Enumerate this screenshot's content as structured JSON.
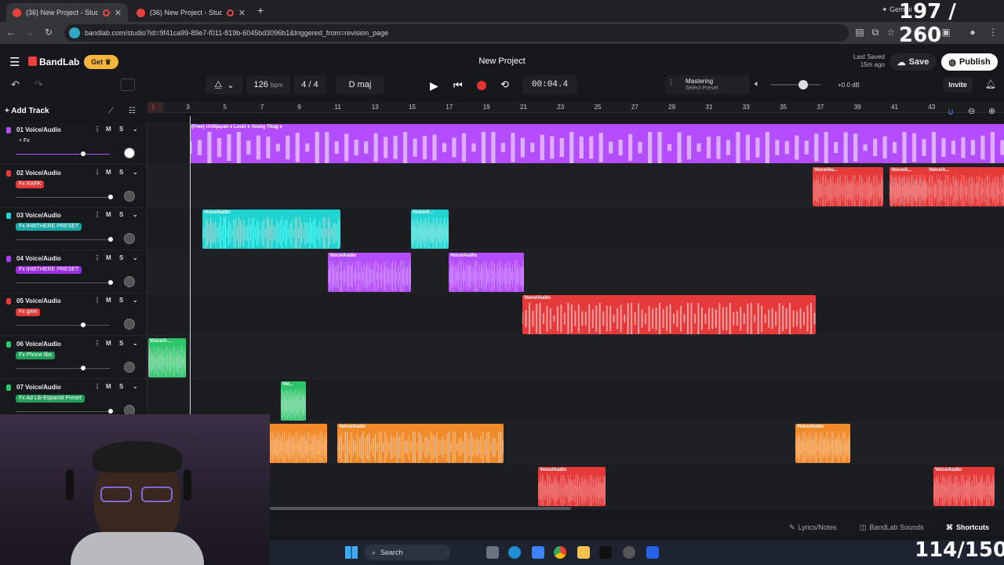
{
  "browser": {
    "tabs": [
      {
        "label": "(36) New Project - Studio",
        "active": true
      },
      {
        "label": "(36) New Project - Studio",
        "active": false
      }
    ],
    "new_tab": "+",
    "url": "bandlab.com/studio?id=9f41ca99-89e7-f011-819b-6045bd3096b1&triggered_from=revision_page",
    "gemini_label": "Gemini"
  },
  "header": {
    "logo": "BandLab",
    "get_label": "Get",
    "project_title": "New Project",
    "last_saved_label": "Last Saved",
    "last_saved_time": "15m ago",
    "save_label": "Save",
    "publish_label": "Publish"
  },
  "transport": {
    "bpm": "126",
    "bpm_unit": "bpm",
    "time_sig": "4 / 4",
    "key": "D maj",
    "time": "00:04.4",
    "mastering": "Mastering",
    "select_preset": "Select Preset",
    "volume_db": "+0.0 dB",
    "invite_label": "Invite"
  },
  "add_track_label": "Add Track",
  "ruler": [
    "1",
    "3",
    "5",
    "7",
    "9",
    "11",
    "13",
    "15",
    "17",
    "19",
    "21",
    "23",
    "25",
    "27",
    "29",
    "31",
    "33",
    "35",
    "37",
    "39",
    "41",
    "43"
  ],
  "tracks": [
    {
      "num": "01",
      "name": "Voice/Audio",
      "fx": "+ Fx",
      "color": "#b44cff",
      "fxbg": "transparent",
      "vol": 0.7
    },
    {
      "num": "02",
      "name": "Voice/Audio",
      "fx": "Fx RAFK",
      "color": "#e63a3a",
      "fxbg": "#e63a3a",
      "vol": 0.98
    },
    {
      "num": "03",
      "name": "Voice/Audio",
      "fx": "Fx IH8ITHERE PRESET",
      "color": "#1fd4d0",
      "fxbg": "#1aa8a6",
      "vol": 0.98
    },
    {
      "num": "04",
      "name": "Voice/Audio",
      "fx": "Fx IH8ITHERE PRESET",
      "color": "#a23cff",
      "fxbg": "#9a2fe0",
      "vol": 0.98
    },
    {
      "num": "05",
      "name": "Voice/Audio",
      "fx": "Fx grim",
      "color": "#e63a3a",
      "fxbg": "#e63a3a",
      "vol": 0.7
    },
    {
      "num": "06",
      "name": "Voice/Audio",
      "fx": "Fx Phone libs",
      "color": "#2ec46a",
      "fxbg": "#22a05a",
      "vol": 0.7
    },
    {
      "num": "07",
      "name": "Voice/Audio",
      "fx": "Fx Ad Lib Espacial Preset",
      "color": "#2ec46a",
      "fxbg": "#22a05a",
      "vol": 0.98
    }
  ],
  "mute_label": "M",
  "solo_label": "S",
  "clip_titles": {
    "main": "(Free) Untiljapan x Lucki x Young Thug x",
    "va": "Voice/Audio",
    "va_a": "Voice/A...",
    "va_au": "Voice/Au...",
    "vo": "Voi..."
  },
  "bottom": {
    "lyrics": "Lyrics/Notes",
    "sounds": "BandLab Sounds",
    "shortcuts": "Shortcuts"
  },
  "taskbar": {
    "search": "Search"
  },
  "overlay": {
    "counter_top": "197 / 260",
    "counter_bottom": "114/150"
  },
  "colors": {
    "purple": "#b44cff",
    "red": "#e63a3a",
    "cyan": "#1fd4d0",
    "green": "#2ec46a",
    "orange": "#f08a2a",
    "accent": "#f6b53c"
  }
}
